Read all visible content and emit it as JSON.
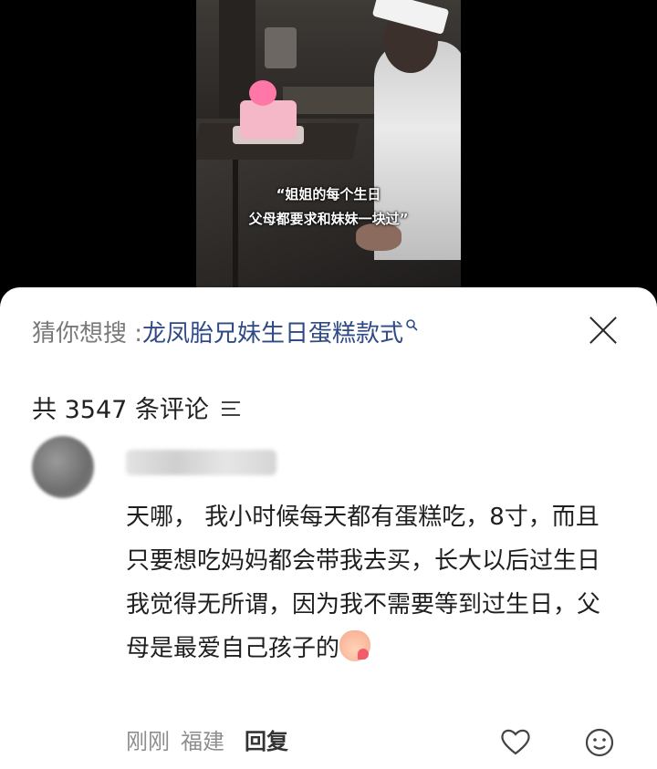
{
  "video": {
    "caption_line1": "“姐姐的每个生日",
    "caption_line2": "父母都要求和妹妹一块过”"
  },
  "search_suggestion": {
    "prefix": "猜你想搜 : ",
    "query": "龙凤胎兄妹生日蛋糕款式",
    "search_icon": "search-icon"
  },
  "comments_header": {
    "count_label": "共 3547 条评论",
    "sort_icon": "sort-icon"
  },
  "comment": {
    "text": "天哪， 我小时候每天都有蛋糕吃，8寸，而且只要想吃妈妈都会带我去买，长大以后过生日我觉得无所谓，因为我不需要等到过生日，父母是最爱自己孩子的",
    "time": "刚刚",
    "location": "福建",
    "reply_label": "回复",
    "emoji": "blush-emoji",
    "like_icon": "heart-icon",
    "react_icon": "emoji-face-icon"
  },
  "colors": {
    "link": "#2f4a86",
    "muted": "#8e8e8e",
    "text": "#1f1f1f"
  }
}
